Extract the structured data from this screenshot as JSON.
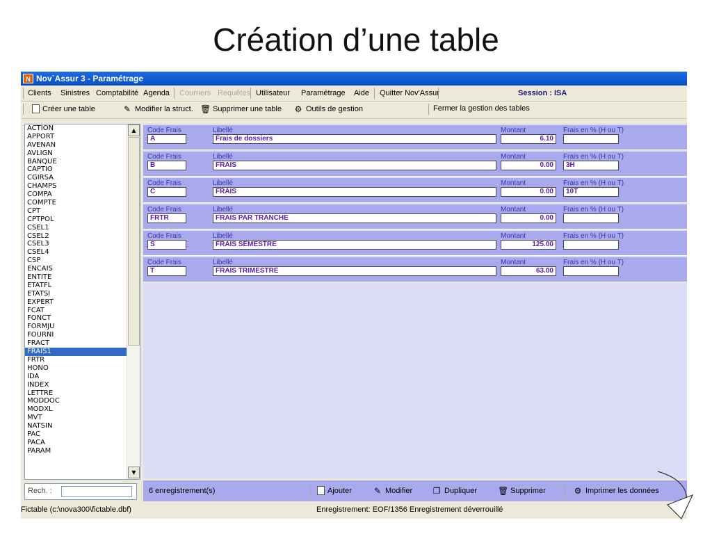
{
  "slide": {
    "title": "Création d’une table"
  },
  "window": {
    "title": "Nov`Assur 3 - Paramétrage",
    "app_icon": "N"
  },
  "menu": {
    "items": [
      "Clients",
      "Sinistres",
      "Comptabilité",
      "Agenda",
      "Courriers",
      "Requêtes",
      "Utilisateur",
      "Paramétrage",
      "Aide",
      "Quitter Nov'Assur"
    ],
    "session": "Session : ISA"
  },
  "toolbar": {
    "create_table": "Créer une table",
    "modify_struct": "Modifier la struct.",
    "delete_table": "Supprimer une table",
    "tools": "Outils de gestion",
    "close": "Fermer la gestion des tables"
  },
  "tables": [
    "ACTION",
    "APPORT",
    "AVENAN",
    "AVLIGN",
    "BANQUE",
    "CAPTIO",
    "CGIRSA",
    "CHAMPS",
    "COMPA",
    "COMPTE",
    "CPT",
    "CPTPOL",
    "CSEL1",
    "CSEL2",
    "CSEL3",
    "CSEL4",
    "CSP",
    "ENCAIS",
    "ENTITE",
    "ETATFL",
    "ETATSI",
    "EXPERT",
    "FCAT",
    "FONCT",
    "FORMJU",
    "FOURNI",
    "FRACT",
    "FRAIS1",
    "FRTR",
    "HONO",
    "IDA",
    "INDEX",
    "LETTRE",
    "MODDOC",
    "MODXL",
    "MVT",
    "NATSIN",
    "PAC",
    "PACA",
    "PARAM"
  ],
  "selected_table": "FRAIS1",
  "columns": {
    "code": "Code Frais",
    "libelle": "Libellé",
    "montant": "Montant",
    "pct": "Frais en % (H ou T)"
  },
  "records": [
    {
      "code": "A",
      "libelle": "Frais de dossiers",
      "montant": "6.10",
      "pct": ""
    },
    {
      "code": "B",
      "libelle": "FRAIS",
      "montant": "0.00",
      "pct": "3H"
    },
    {
      "code": "C",
      "libelle": "FRAIS",
      "montant": "0.00",
      "pct": "10T"
    },
    {
      "code": "FRTR",
      "libelle": "FRAIS PAR TRANCHE",
      "montant": "0.00",
      "pct": ""
    },
    {
      "code": "S",
      "libelle": "FRAIS SEMESTRE",
      "montant": "125.00",
      "pct": ""
    },
    {
      "code": "T",
      "libelle": "FRAIS TRIMESTRE",
      "montant": "63.00",
      "pct": ""
    }
  ],
  "bottom": {
    "search_label": "Rech. :",
    "count": "6 enregistrement(s)",
    "add": "Ajouter",
    "modify": "Modifier",
    "duplicate": "Dupliquer",
    "delete": "Supprimer",
    "print": "Imprimer les données"
  },
  "status": {
    "file": "Fictable (c:\\nova300\\fictable.dbf)",
    "record": "Enregistrement: EOF/1356 Enregistrement déverrouillé"
  }
}
